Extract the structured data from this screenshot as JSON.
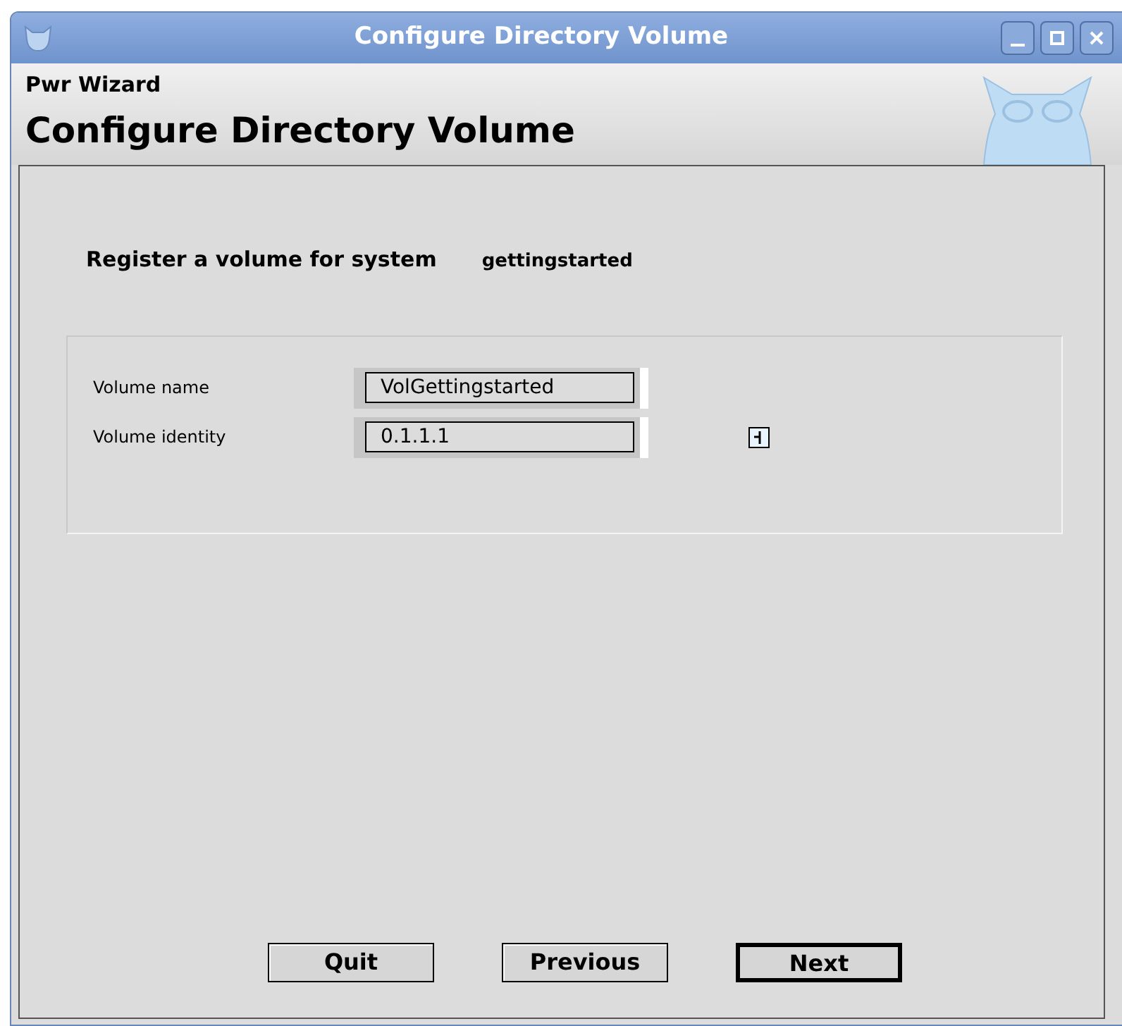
{
  "window": {
    "title": "Configure Directory Volume"
  },
  "header": {
    "app": "Pwr Wizard",
    "title": "Configure Directory Volume"
  },
  "register": {
    "label": "Register a volume for system",
    "system": "gettingstarted"
  },
  "fields": [
    {
      "label": "Volume name",
      "value": "VolGettingstarted",
      "has_button": false
    },
    {
      "label": "Volume identity",
      "value": "0.1.1.1",
      "has_button": true
    }
  ],
  "buttons": [
    {
      "label": "Quit",
      "default": false
    },
    {
      "label": "Previous",
      "default": false
    },
    {
      "label": "Next",
      "default": true
    }
  ]
}
